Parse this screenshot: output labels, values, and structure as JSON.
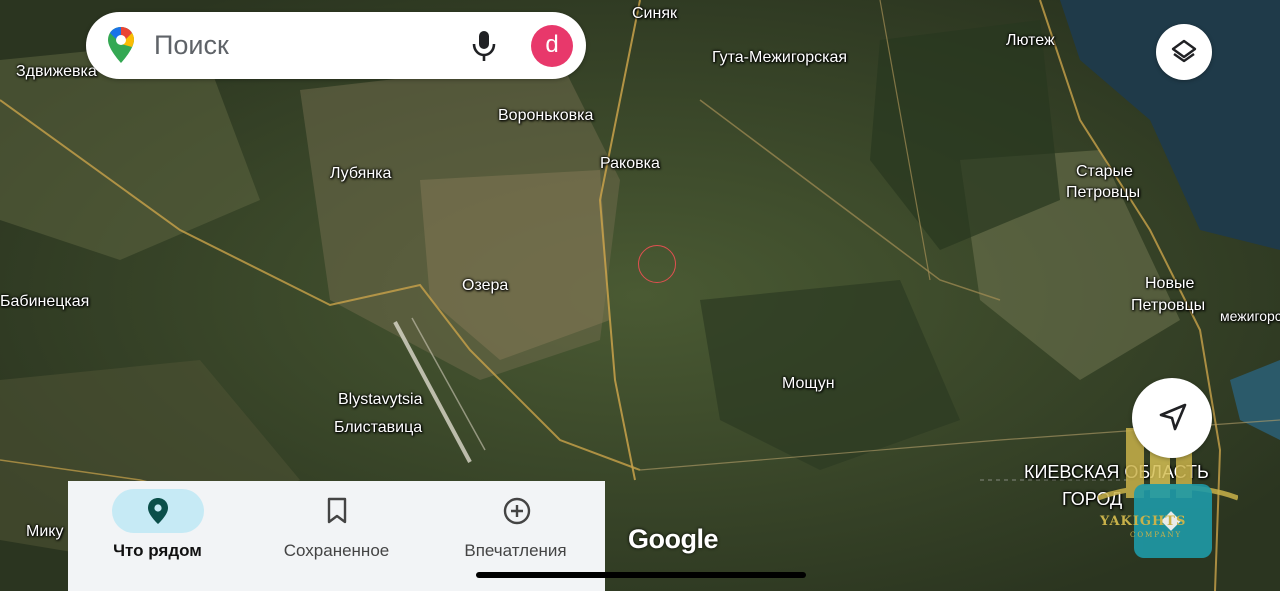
{
  "search": {
    "placeholder": "Поиск",
    "avatar_letter": "d"
  },
  "map": {
    "places": [
      {
        "name": "Синяк"
      },
      {
        "name": "Гута-Межигорская"
      },
      {
        "name": "Лютеж"
      },
      {
        "name": "Здвижевка"
      },
      {
        "name": "Вороньковка"
      },
      {
        "name": "Раковка"
      },
      {
        "name": "Лубянка"
      },
      {
        "name": "Старые"
      },
      {
        "name": "Петровцы"
      },
      {
        "name": "Озера"
      },
      {
        "name": "Новые"
      },
      {
        "name": "Петровцы"
      },
      {
        "name": "межигорс"
      },
      {
        "name": "Бабинецкая"
      },
      {
        "name": "Мощун"
      },
      {
        "name": "Blystavytsia"
      },
      {
        "name": "Блиставица"
      },
      {
        "name": "КИЕВСКАЯ ОБЛАСТЬ"
      },
      {
        "name": "ГОРОД"
      },
      {
        "name": "Мику"
      }
    ],
    "attribution": "Google"
  },
  "watermark": {
    "name": "YAKIGHTS",
    "sub": "COMPANY"
  },
  "bottom_nav": {
    "tabs": [
      {
        "label": "Что рядом",
        "icon": "place-pin-icon",
        "active": true
      },
      {
        "label": "Сохраненное",
        "icon": "bookmark-icon",
        "active": false
      },
      {
        "label": "Впечатления",
        "icon": "add-circle-icon",
        "active": false
      }
    ]
  },
  "colors": {
    "accent": "#c6eaf5",
    "avatar": "#e8386b",
    "brand_pin": "#34a853"
  }
}
